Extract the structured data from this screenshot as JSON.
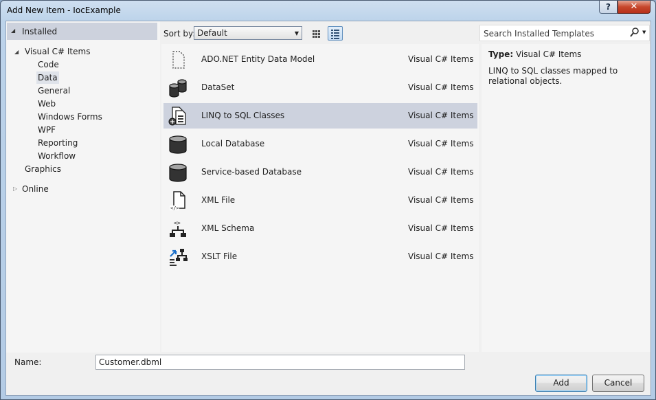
{
  "window": {
    "title": "Add New Item - IocExample",
    "help_glyph": "?",
    "close_glyph": "✕"
  },
  "tree": {
    "installed": "Installed",
    "items": [
      {
        "label": "Visual C# Items",
        "level": 1,
        "expanded": true
      },
      {
        "label": "Code",
        "level": 2
      },
      {
        "label": "Data",
        "level": 2,
        "selected": true
      },
      {
        "label": "General",
        "level": 2
      },
      {
        "label": "Web",
        "level": 2
      },
      {
        "label": "Windows Forms",
        "level": 2
      },
      {
        "label": "WPF",
        "level": 2
      },
      {
        "label": "Reporting",
        "level": 2
      },
      {
        "label": "Workflow",
        "level": 2
      },
      {
        "label": "Graphics",
        "level": 1
      }
    ],
    "online": "Online"
  },
  "toolbar": {
    "sort_label": "Sort by:",
    "sort_value": "Default"
  },
  "templates": [
    {
      "name": "ADO.NET Entity Data Model",
      "category": "Visual C# Items",
      "icon": "entity-model-icon"
    },
    {
      "name": "DataSet",
      "category": "Visual C# Items",
      "icon": "dataset-icon"
    },
    {
      "name": "LINQ to SQL Classes",
      "category": "Visual C# Items",
      "icon": "linq-to-sql-icon",
      "selected": true
    },
    {
      "name": "Local Database",
      "category": "Visual C# Items",
      "icon": "database-icon"
    },
    {
      "name": "Service-based Database",
      "category": "Visual C# Items",
      "icon": "database-icon"
    },
    {
      "name": "XML File",
      "category": "Visual C# Items",
      "icon": "xml-file-icon"
    },
    {
      "name": "XML Schema",
      "category": "Visual C# Items",
      "icon": "xml-schema-icon"
    },
    {
      "name": "XSLT File",
      "category": "Visual C# Items",
      "icon": "xslt-file-icon"
    }
  ],
  "search": {
    "placeholder": "Search Installed Templates"
  },
  "details": {
    "type_label": "Type:",
    "type_value": "Visual C# Items",
    "description": "LINQ to SQL classes mapped to relational objects."
  },
  "bottom": {
    "name_label": "Name:",
    "name_value": "Customer.dbml",
    "add_label": "Add",
    "cancel_label": "Cancel"
  }
}
